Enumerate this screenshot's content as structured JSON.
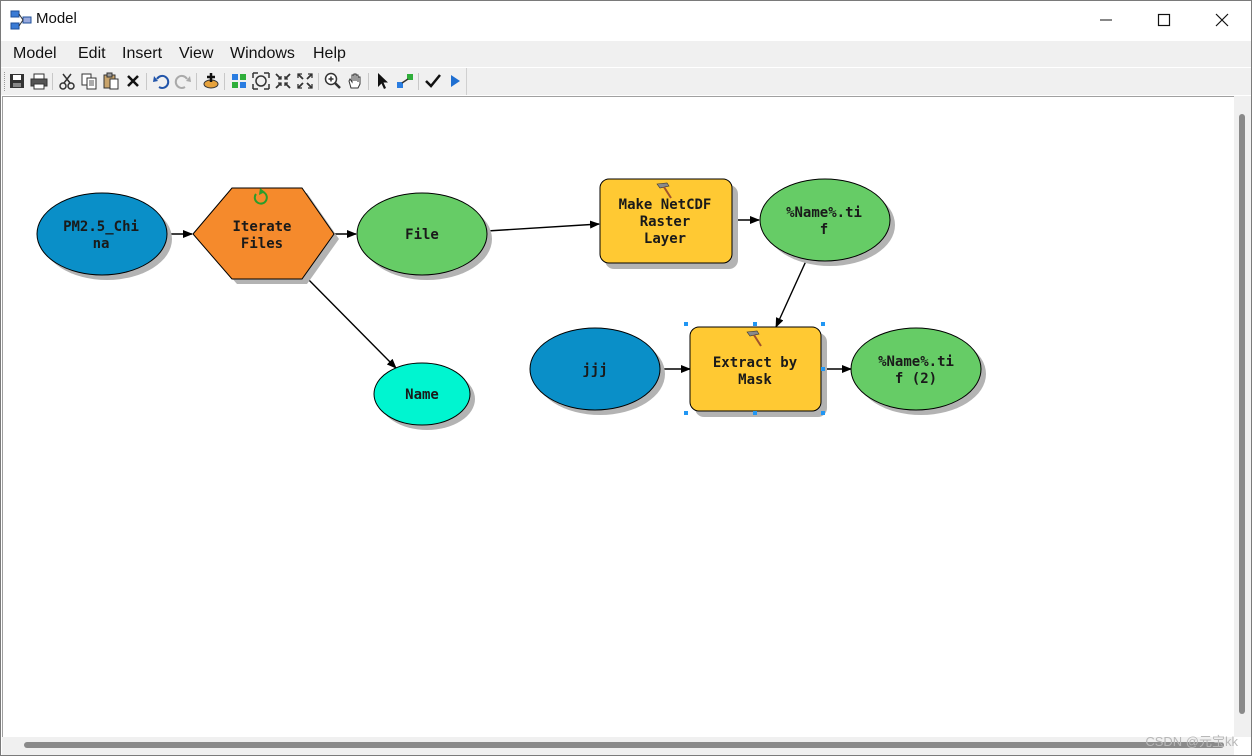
{
  "window": {
    "title": "Model",
    "controls": {
      "minimize": "minimize",
      "maximize": "maximize",
      "close": "close"
    }
  },
  "menu": [
    "Model",
    "Edit",
    "Insert",
    "View",
    "Windows",
    "Help"
  ],
  "toolbar": {
    "icons": [
      "save-icon",
      "print-icon",
      "cut-icon",
      "copy-icon",
      "paste-icon",
      "delete-icon",
      "undo-icon",
      "redo-icon",
      "add-data-icon",
      "auto-layout-icon",
      "full-extent-icon",
      "fixed-zoom-in-icon",
      "fixed-zoom-out-icon",
      "zoom-in-icon",
      "pan-icon",
      "select-icon",
      "connect-icon",
      "validate-icon",
      "run-icon"
    ]
  },
  "model": {
    "colors": {
      "input_variable": "#0a8fc8",
      "iterator": "#f58a2c",
      "derived_data": "#66cc66",
      "tool": "#ffc933",
      "parameter": "#00f5d0",
      "selection": "#2196f3"
    },
    "nodes": {
      "pm25": {
        "label_lines": [
          "PM2.5_Chi",
          "na"
        ],
        "kind": "input_variable"
      },
      "iterate": {
        "label_lines": [
          "Iterate",
          "Files"
        ],
        "kind": "iterator"
      },
      "file": {
        "label_lines": [
          "File"
        ],
        "kind": "derived_data"
      },
      "name": {
        "label_lines": [
          "Name"
        ],
        "kind": "parameter"
      },
      "netcdf": {
        "label_lines": [
          "Make NetCDF",
          "Raster",
          "Layer"
        ],
        "kind": "tool"
      },
      "tif1": {
        "label_lines": [
          "%Name%.ti",
          "f"
        ],
        "kind": "derived_data"
      },
      "jjj": {
        "label_lines": [
          "jjj"
        ],
        "kind": "input_variable"
      },
      "extract": {
        "label_lines": [
          "Extract by",
          "Mask"
        ],
        "kind": "tool",
        "selected": true
      },
      "tif2": {
        "label_lines": [
          "%Name%.ti",
          "f (2)"
        ],
        "kind": "derived_data"
      }
    },
    "connections": [
      [
        "pm25",
        "iterate"
      ],
      [
        "iterate",
        "file"
      ],
      [
        "iterate",
        "name"
      ],
      [
        "file",
        "netcdf"
      ],
      [
        "netcdf",
        "tif1"
      ],
      [
        "tif1",
        "extract"
      ],
      [
        "jjj",
        "extract"
      ],
      [
        "extract",
        "tif2"
      ]
    ]
  },
  "watermark": "CSDN @元宝kk"
}
